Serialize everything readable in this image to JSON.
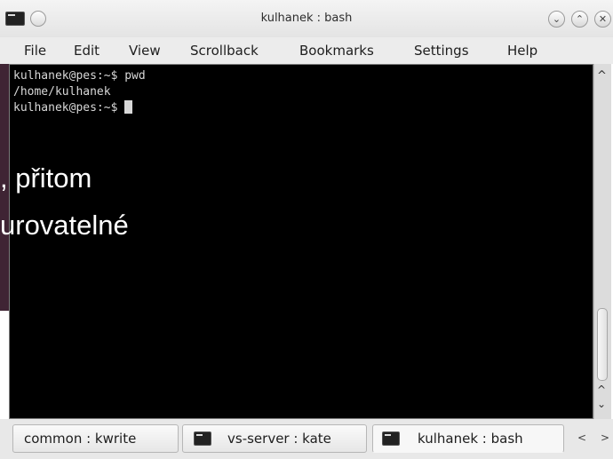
{
  "window": {
    "title": "kulhanek : bash",
    "controls": {
      "minimize": "⌄",
      "maximize": "⌃",
      "close": "✕"
    }
  },
  "menu": {
    "items": [
      "File",
      "Edit",
      "View",
      "Scrollback",
      "Bookmarks",
      "Settings",
      "Help"
    ]
  },
  "terminal": {
    "lines": [
      "kulhanek@pes:~$ pwd",
      "/home/kulhanek",
      "kulhanek@pes:~$ "
    ]
  },
  "overlay": {
    "line1": ", přitom",
    "line2": "urovatelné"
  },
  "scrollbar": {
    "up": "^",
    "down_up": "^",
    "down": "⌄"
  },
  "tabs": [
    {
      "label": "common : kwrite"
    },
    {
      "label": "vs-server : kate"
    },
    {
      "label": "kulhanek : bash"
    }
  ],
  "tab_nav": {
    "prev": "<",
    "next": ">"
  },
  "colors": {
    "terminal_bg": "#000000",
    "terminal_fg": "#d8d8d8",
    "slide_bg": "#3f2434"
  }
}
